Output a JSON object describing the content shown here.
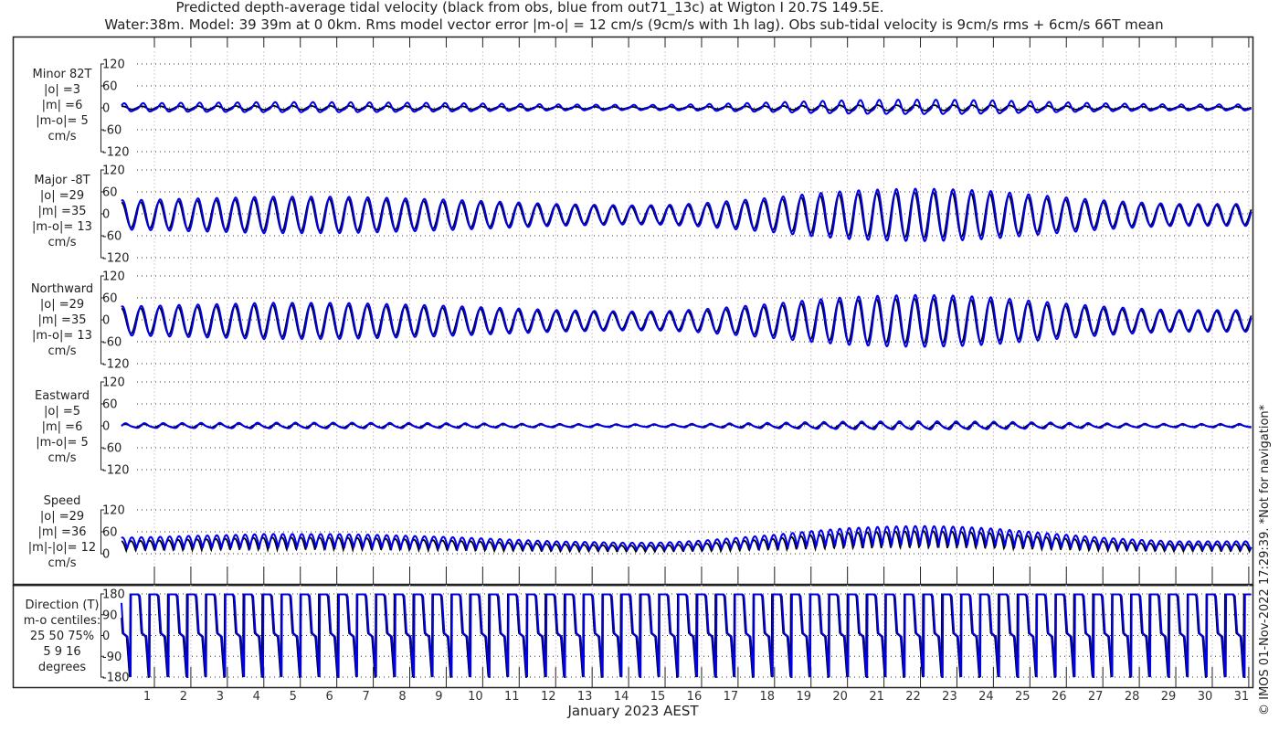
{
  "chart_data": {
    "type": "line",
    "title_line1": "Predicted depth-average tidal velocity (black from obs, blue from out71_13c) at Wigton I 20.7S 149.5E.",
    "title_line2": "Water:38m. Model: 39 39m at 0 0km. Rms model vector error |m-o| = 12 cm/s (9cm/s with 1h lag). Obs sub-tidal velocity is 9cm/s rms + 6cm/s 66T mean",
    "xlabel": "January 2023 AEST",
    "x_ticks": [
      "1",
      "2",
      "3",
      "4",
      "5",
      "6",
      "7",
      "8",
      "9",
      "10",
      "11",
      "12",
      "13",
      "14",
      "15",
      "16",
      "17",
      "18",
      "19",
      "20",
      "21",
      "22",
      "23",
      "24",
      "25",
      "26",
      "27",
      "28",
      "29",
      "30",
      "31"
    ],
    "copyright": "© IMOS 01-Nov-2022 17:29:39. *Not for navigation*",
    "series_colors": {
      "obs": "#000000",
      "model": "#0000ee"
    },
    "tidal_period_hours": 12.42,
    "model_lag_hours": 0.6,
    "daily_amplitude_model": [
      40,
      42,
      45,
      47,
      50,
      50,
      50,
      48,
      45,
      42,
      38,
      34,
      30,
      28,
      26,
      27,
      32,
      40,
      48,
      58,
      66,
      70,
      72,
      70,
      65,
      56,
      48,
      40,
      34,
      30,
      30
    ],
    "daily_amplitude_obs": [
      34,
      36,
      39,
      41,
      44,
      44,
      44,
      42,
      39,
      36,
      33,
      29,
      26,
      24,
      22,
      23,
      27,
      34,
      41,
      50,
      57,
      60,
      62,
      60,
      56,
      48,
      41,
      34,
      29,
      26,
      26
    ],
    "panels": [
      {
        "key": "minor",
        "label_lines": [
          "Minor 82T",
          "|o| =3",
          "|m| =6",
          "|m-o|= 5",
          "cm/s"
        ],
        "yticks": [
          "120",
          "60",
          "0",
          "-60",
          "-120"
        ],
        "ylim": [
          -120,
          120
        ],
        "scale_obs": 0.12,
        "scale_model": 0.25
      },
      {
        "key": "major",
        "label_lines": [
          "Major -8T",
          "|o| =29",
          "|m| =35",
          "|m-o|= 13",
          "cm/s"
        ],
        "yticks": [
          "120",
          "60",
          "0",
          "-60",
          "-120"
        ],
        "ylim": [
          -120,
          120
        ],
        "scale_obs": 1,
        "scale_model": 1
      },
      {
        "key": "north",
        "label_lines": [
          "Northward",
          "|o| =29",
          "|m| =35",
          "|m-o|= 13",
          "cm/s"
        ],
        "yticks": [
          "120",
          "60",
          "0",
          "-60",
          "-120"
        ],
        "ylim": [
          -120,
          120
        ],
        "scale_obs": 0.99,
        "scale_model": 0.99
      },
      {
        "key": "east",
        "label_lines": [
          "Eastward",
          "|o| =5",
          "|m| =6",
          "|m-o|= 5",
          "cm/s"
        ],
        "yticks": [
          "120",
          "60",
          "0",
          "-60",
          "-120"
        ],
        "ylim": [
          -120,
          120
        ],
        "scale_obs": 0.12,
        "scale_model": 0.14
      },
      {
        "key": "speed",
        "label_lines": [
          "Speed",
          "|o| =29",
          "|m| =36",
          "|m|-|o|= 12",
          "cm/s"
        ],
        "yticks": [
          "120",
          "60",
          "0"
        ],
        "ylim": [
          0,
          120
        ],
        "scale_obs": 1,
        "scale_model": 1
      },
      {
        "key": "direction",
        "label_lines": [
          "Direction (T)",
          "m-o centiles:",
          "25  50  75%",
          "5   9  16",
          "degrees"
        ],
        "yticks": [
          "180",
          "90",
          "0",
          "-90",
          "-180"
        ],
        "ylim": [
          -180,
          180
        ],
        "scale_obs": 1,
        "scale_model": 1
      }
    ]
  }
}
